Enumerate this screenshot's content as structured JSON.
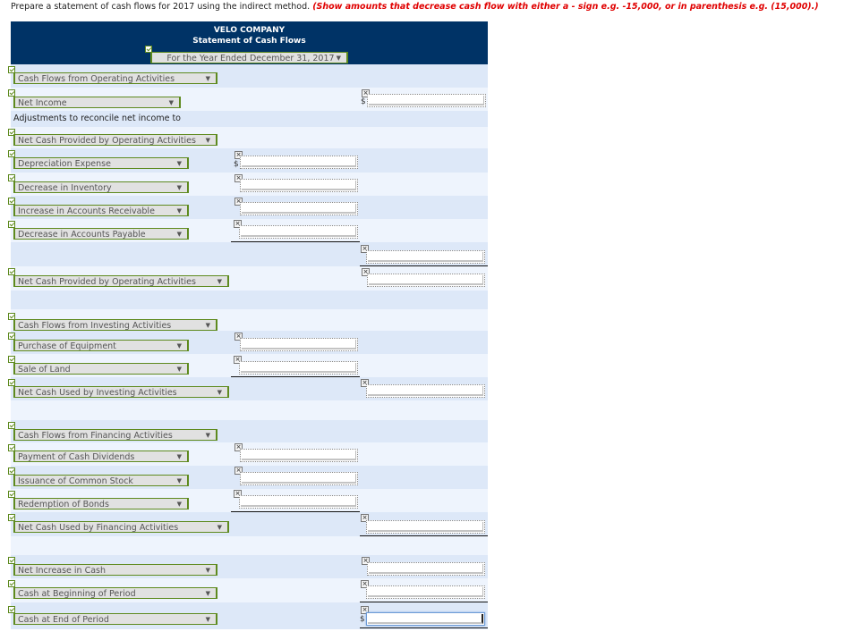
{
  "instructions": {
    "text": "Prepare a statement of cash flows for 2017 using the indirect method.",
    "note": "(Show amounts that decrease cash flow with either a - sign e.g. -15,000, or in parenthesis e.g. (15,000).)"
  },
  "header": {
    "company": "VELO COMPANY",
    "statement": "Statement of Cash Flows",
    "period": "For the Year Ended December 31, 2017"
  },
  "rows": {
    "op_heading": "Cash Flows from Operating Activities",
    "net_income": "Net Income",
    "adjustments_text": "Adjustments to reconcile net income to",
    "adj_heading": "Net Cash Provided by Operating Activities",
    "depreciation": "Depreciation Expense",
    "dec_inventory": "Decrease in Inventory",
    "inc_ar": "Increase in Accounts Receivable",
    "dec_ap": "Decrease in Accounts Payable",
    "net_op": "Net Cash Provided by Operating Activities",
    "inv_heading": "Cash Flows from Investing Activities",
    "purchase_equipment": "Purchase of Equipment",
    "sale_land": "Sale of Land",
    "net_inv": "Net Cash Used by Investing Activities",
    "fin_heading": "Cash Flows from Financing Activities",
    "dividends": "Payment of Cash Dividends",
    "stock": "Issuance of Common Stock",
    "bonds": "Redemption of Bonds",
    "net_fin": "Net Cash Used by Financing Activities",
    "net_increase": "Net Increase in Cash",
    "cash_begin": "Cash at Beginning of Period",
    "cash_end": "Cash at End of Period"
  },
  "symbols": {
    "dollar": "$",
    "arrow": "▼",
    "x": "×"
  },
  "inputs": {
    "net_income": "",
    "depreciation": "",
    "dec_inventory": "",
    "inc_ar": "",
    "dec_ap": "",
    "total_adjustments": "",
    "net_op": "",
    "purchase_equipment": "",
    "sale_land": "",
    "net_inv": "",
    "dividends": "",
    "stock": "",
    "bonds": "",
    "net_fin": "",
    "net_increase": "",
    "cash_begin": "",
    "cash_end": ""
  }
}
